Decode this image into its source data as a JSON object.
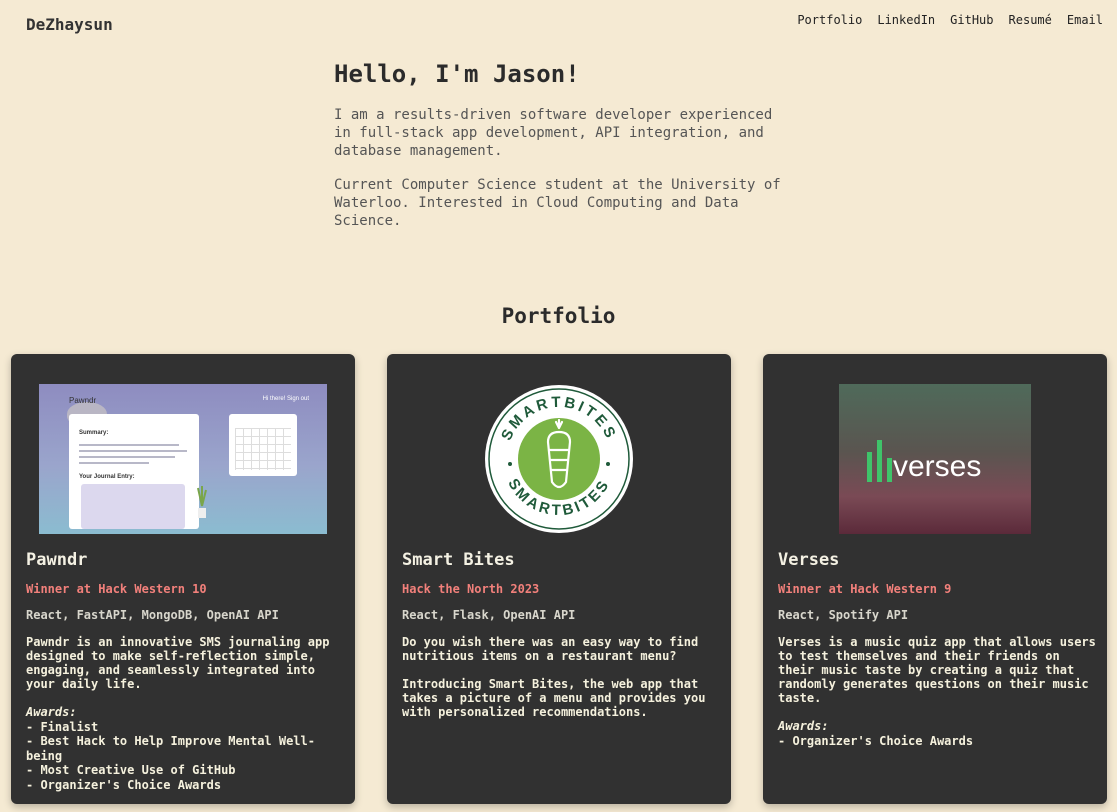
{
  "header": {
    "brand": "DeZhaysun",
    "nav": [
      "Portfolio",
      "LinkedIn",
      "GitHub",
      "Resumé",
      "Email"
    ]
  },
  "hero": {
    "title": "Hello, I'm Jason!",
    "para1": "I am a results-driven software developer experienced in full-stack app development, API integration, and database management.",
    "para2": "Current Computer Science student at the University of Waterloo. Interested in Cloud Computing and Data Science."
  },
  "portfolio": {
    "title": "Portfolio",
    "cards": [
      {
        "name": "Pawndr",
        "award": "Winner at Hack Western 10",
        "stack": "React, FastAPI, MongoDB, OpenAI API",
        "desc": [
          "Pawndr is an innovative SMS journaling app designed to make self-reflection simple, engaging, and seamlessly integrated into your daily life."
        ],
        "awards_label": "Awards:",
        "awards": [
          "- Finalist",
          "- Best Hack to Help Improve Mental Well-being",
          "- Most Creative Use of GitHub",
          "- Organizer's Choice Awards"
        ],
        "thumb": {
          "title": "Pawndr",
          "link": "Hi there! Sign out",
          "summary_label": "Summary:",
          "entry_label": "Your Journal Entry:"
        }
      },
      {
        "name": "Smart Bites",
        "award": "Hack the North 2023",
        "stack": "React, Flask, OpenAI API",
        "desc": [
          "Do you wish there was an easy way to find nutritious items on a restaurant menu?",
          "Introducing Smart Bites, the web app that takes a picture of a menu and provides you with personalized recommendations."
        ],
        "awards_label": "",
        "awards": [],
        "thumb": {
          "ring_text": "SMARTBITES"
        }
      },
      {
        "name": "Verses",
        "award": "Winner at Hack Western 9",
        "stack": "React, Spotify API",
        "desc": [
          "Verses is a music quiz app that allows users to test themselves and their friends on their music taste by creating a quiz that randomly generates questions on their music taste."
        ],
        "awards_label": "Awards:",
        "awards": [
          "- Organizer's Choice Awards"
        ],
        "thumb": {
          "logo_text": "verses"
        }
      }
    ]
  },
  "colors": {
    "background": "#f5ead3",
    "card": "#313131",
    "accent_award": "#f2807b",
    "smartbites_green": "#7bb445",
    "smartbites_dark": "#1f5a3a",
    "verses_bar": "#3fc46a"
  }
}
